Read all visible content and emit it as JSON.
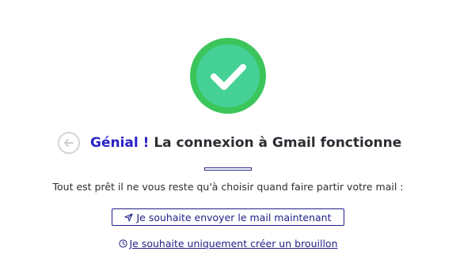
{
  "colors": {
    "success_outer": "#3bc55a",
    "success_inner": "#45d196",
    "accent": "#2a22c9",
    "navy": "#1f1f87"
  },
  "icons": {
    "success": "check-icon",
    "back": "arrow-left-icon",
    "send": "paper-plane-icon",
    "draft": "clock-icon"
  },
  "header": {
    "accent": "Génial !",
    "title": "La connexion à Gmail fonctionne"
  },
  "body": {
    "intro": "Tout est prêt il ne vous reste qu'à choisir quand faire partir votre mail :"
  },
  "actions": {
    "send_now": "Je souhaite envoyer le mail maintenant",
    "draft_only": "Je souhaite uniquement créer un brouillon"
  }
}
